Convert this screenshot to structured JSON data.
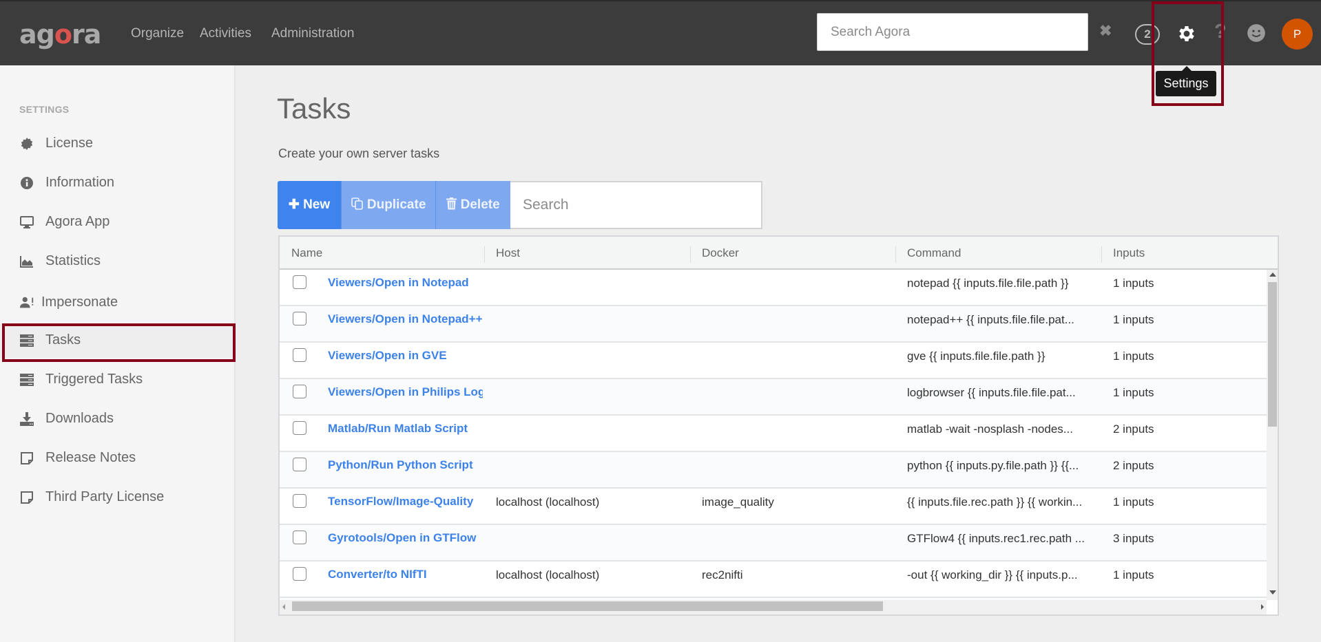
{
  "header": {
    "logo": {
      "prefix": "ag",
      "highlight": "o",
      "suffix": "ra"
    },
    "nav": [
      "Organize",
      "Activities",
      "Administration"
    ],
    "search_placeholder": "Search Agora",
    "notification_count": "2",
    "avatar_initial": "P",
    "tooltip": "Settings",
    "icons": [
      "clear-icon",
      "gear-icon",
      "help-icon",
      "smile-icon"
    ]
  },
  "sidebar": {
    "section_title": "SETTINGS",
    "items": [
      {
        "label": "License",
        "icon": "badge-icon"
      },
      {
        "label": "Information",
        "icon": "info-icon"
      },
      {
        "label": "Agora App",
        "icon": "desktop-icon"
      },
      {
        "label": "Statistics",
        "icon": "area-chart-icon"
      },
      {
        "label": "Impersonate",
        "icon": "user-alert-icon"
      },
      {
        "label": "Tasks",
        "icon": "server-icon",
        "active": true
      },
      {
        "label": "Triggered Tasks",
        "icon": "server-icon"
      },
      {
        "label": "Downloads",
        "icon": "download-icon"
      },
      {
        "label": "Release Notes",
        "icon": "note-icon"
      },
      {
        "label": "Third Party License",
        "icon": "note-icon"
      }
    ]
  },
  "main": {
    "title": "Tasks",
    "subtitle": "Create your own server tasks",
    "toolbar": {
      "new_label": "New",
      "duplicate_label": "Duplicate",
      "delete_label": "Delete",
      "search_placeholder": "Search"
    },
    "table": {
      "columns": [
        "Name",
        "Host",
        "Docker",
        "Command",
        "Inputs"
      ],
      "rows": [
        {
          "name": "Viewers/Open in Notepad",
          "host": "",
          "docker": "",
          "command": "notepad {{ inputs.file.file.path }}",
          "inputs": "1 inputs"
        },
        {
          "name": "Viewers/Open in Notepad++",
          "host": "",
          "docker": "",
          "command": "notepad++ {{ inputs.file.file.pat...",
          "inputs": "1 inputs"
        },
        {
          "name": "Viewers/Open in GVE",
          "host": "",
          "docker": "",
          "command": "gve {{ inputs.file.file.path }}",
          "inputs": "1 inputs"
        },
        {
          "name": "Viewers/Open in Philips Logbrowser",
          "host": "",
          "docker": "",
          "command": "logbrowser {{ inputs.file.file.pat...",
          "inputs": "1 inputs"
        },
        {
          "name": "Matlab/Run Matlab Script",
          "host": "",
          "docker": "",
          "command": "matlab -wait -nosplash -nodes...",
          "inputs": "2 inputs"
        },
        {
          "name": "Python/Run Python Script",
          "host": "",
          "docker": "",
          "command": "python {{ inputs.py.file.path }} {{...",
          "inputs": "2 inputs"
        },
        {
          "name": "TensorFlow/Image-Quality",
          "host": "localhost (localhost)",
          "docker": "image_quality",
          "command": "{{ inputs.file.rec.path }} {{ workin...",
          "inputs": "1 inputs"
        },
        {
          "name": "Gyrotools/Open in GTFlow",
          "host": "",
          "docker": "",
          "command": "GTFlow4 {{ inputs.rec1.rec.path ...",
          "inputs": "3 inputs"
        },
        {
          "name": "Converter/to NIfTI",
          "host": "localhost (localhost)",
          "docker": "rec2nifti",
          "command": "-out {{ working_dir }} {{ inputs.p...",
          "inputs": "1 inputs"
        },
        {
          "name": "",
          "host": "",
          "docker": "",
          "command": "",
          "inputs": ""
        }
      ]
    }
  },
  "colors": {
    "header_bg": "#3c3c3c",
    "accent_blue": "#3f84ee",
    "link_blue": "#3c82e8",
    "avatar": "#d35400",
    "highlight_box": "#86001a",
    "logo_o": "#d9534f"
  }
}
